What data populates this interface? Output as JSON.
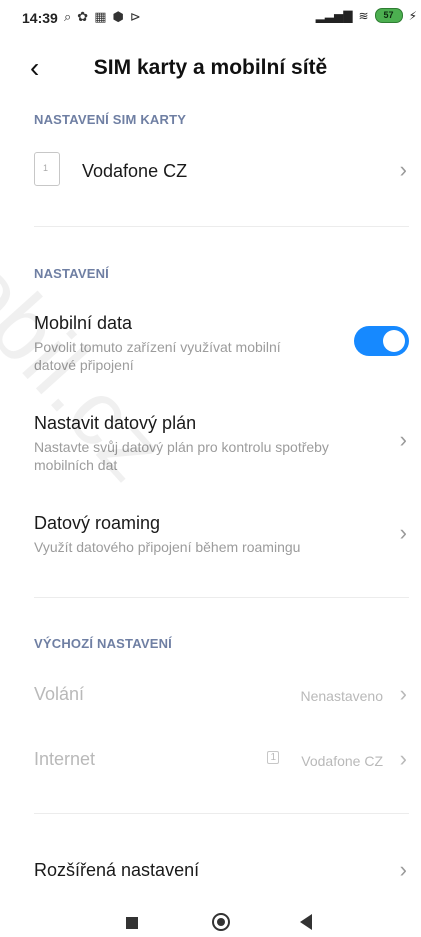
{
  "status": {
    "time": "14:39",
    "battery": "57"
  },
  "header": {
    "title": "SIM karty a mobilní sítě"
  },
  "sections": {
    "sim_settings": "NASTAVENÍ SIM KARTY",
    "settings": "NASTAVENÍ",
    "default_settings": "VÝCHOZÍ NASTAVENÍ"
  },
  "sim": {
    "label": "Vodafone CZ",
    "slot": "1"
  },
  "settings_items": {
    "mobile_data_title": "Mobilní data",
    "mobile_data_sub": "Povolit tomuto zařízení využívat mobilní datové připojení",
    "data_plan_title": "Nastavit datový plán",
    "data_plan_sub": "Nastavte svůj datový plán pro kontrolu spotřeby mobilních dat",
    "roaming_title": "Datový roaming",
    "roaming_sub": "Využít datového připojení během roamingu"
  },
  "defaults": {
    "calls_label": "Volání",
    "calls_value": "Nenastaveno",
    "internet_label": "Internet",
    "internet_value": "Vodafone CZ",
    "internet_sim_slot": "1"
  },
  "advanced": {
    "label": "Rozšířená nastavení"
  },
  "watermark": {
    "text": "mobil.cz"
  },
  "accent_color": "#1689ff"
}
